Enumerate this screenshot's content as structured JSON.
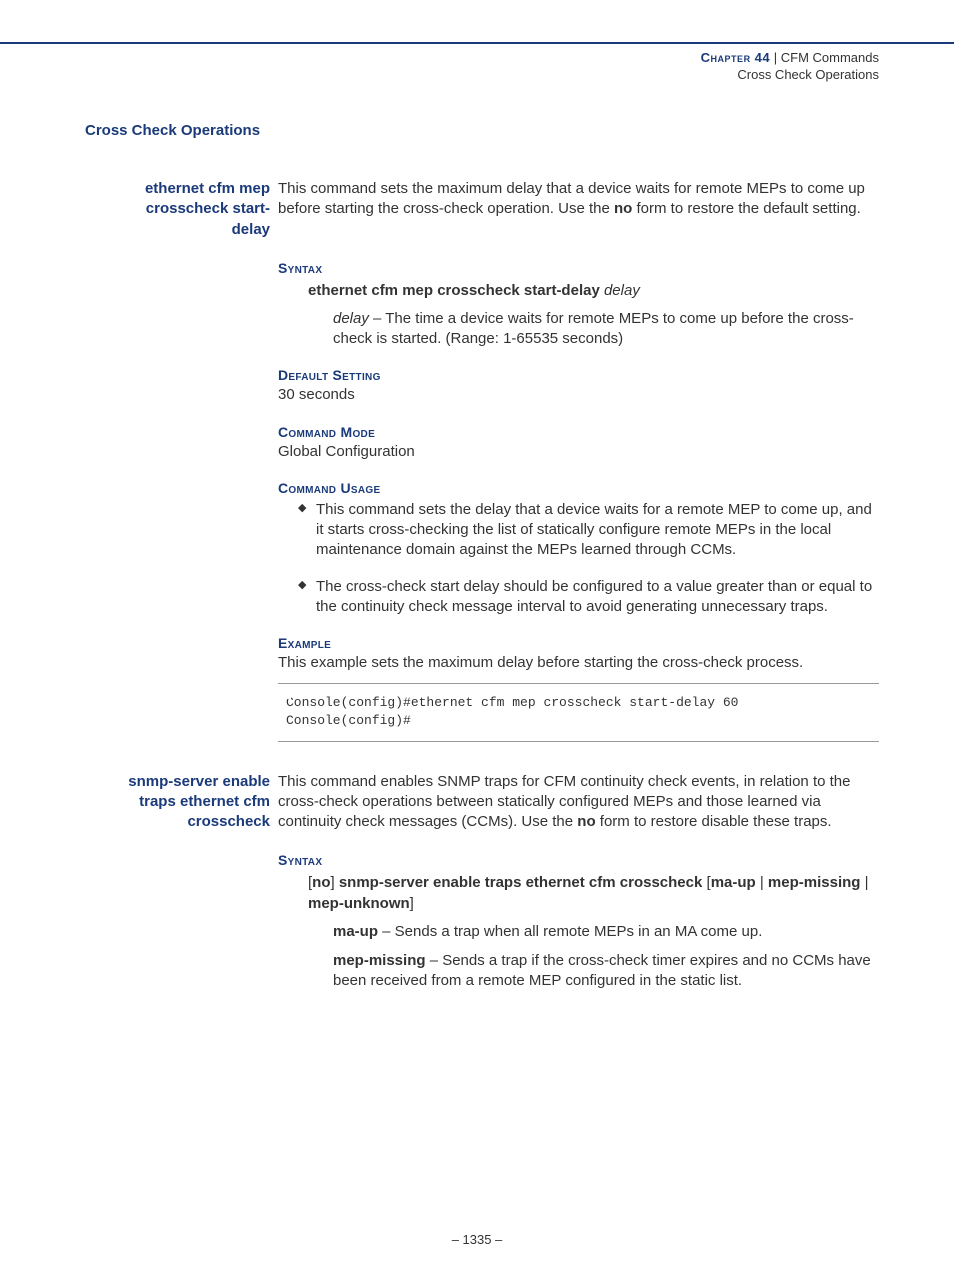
{
  "header": {
    "chapter_label": "Chapter 44",
    "separator": "  |  ",
    "chapter_title": "CFM Commands",
    "subtitle": "Cross Check Operations"
  },
  "section_title": "Cross Check Operations",
  "cmd1": {
    "name_l1": "ethernet cfm mep",
    "name_l2": "crosscheck start-",
    "name_l3": "delay",
    "desc_p1a": "This command sets the maximum delay that a device waits for remote MEPs to come up before starting the cross-check operation. Use the ",
    "desc_p1b": "no",
    "desc_p1c": " form to restore the default setting.",
    "syntax_heading": "Syntax",
    "syntax_cmd_bold": "ethernet cfm mep crosscheck start-delay",
    "syntax_cmd_ital": " delay",
    "param_name": "delay",
    "param_desc": " – The time a device waits for remote MEPs to come up before the cross-check is started. (Range: 1-65535 seconds)",
    "default_heading": "Default Setting",
    "default_value": "30 seconds",
    "mode_heading": "Command Mode",
    "mode_value": "Global Configuration",
    "usage_heading": "Command Usage",
    "usage_b1": "This command sets the delay that a device waits for a remote MEP to come up, and it starts cross-checking the list of statically configure remote MEPs in the local maintenance domain against the MEPs learned through CCMs.",
    "usage_b2": "The cross-check start delay should be configured to a value greater than or equal to the continuity check message interval to avoid generating unnecessary traps.",
    "example_heading": "Example",
    "example_desc": "This example sets the maximum delay before starting the cross-check process.",
    "example_code": "Console(config)#ethernet cfm mep crosscheck start-delay 60\nConsole(config)#"
  },
  "cmd2": {
    "name_l1": "snmp-server enable",
    "name_l2": "traps ethernet cfm",
    "name_l3": "crosscheck",
    "desc_p1a": "This command enables SNMP traps for CFM continuity check events, in relation to the cross-check operations between statically configured MEPs and those learned via continuity check messages (CCMs). Use the ",
    "desc_p1b": "no",
    "desc_p1c": " form to restore disable these traps.",
    "syntax_heading": "Syntax",
    "syntax_line_pre": "[",
    "syntax_no": "no",
    "syntax_mid1": "] ",
    "syntax_main": "snmp-server enable traps ethernet cfm crosscheck",
    "syntax_mid2": " [",
    "syntax_opt1": "ma-up",
    "syntax_sep1": " | ",
    "syntax_opt2": "mep-missing",
    "syntax_sep2": " | ",
    "syntax_opt3": "mep-unknown",
    "syntax_end": "]",
    "p_maup_b": "ma-up",
    "p_maup_t": " – Sends a trap when all remote MEPs in an MA come up.",
    "p_mepm_b": "mep-missing",
    "p_mepm_t": " – Sends a trap if the cross-check timer expires and no CCMs have been received from a remote MEP configured in the static list."
  },
  "footer": {
    "page": "–  1335  –"
  }
}
